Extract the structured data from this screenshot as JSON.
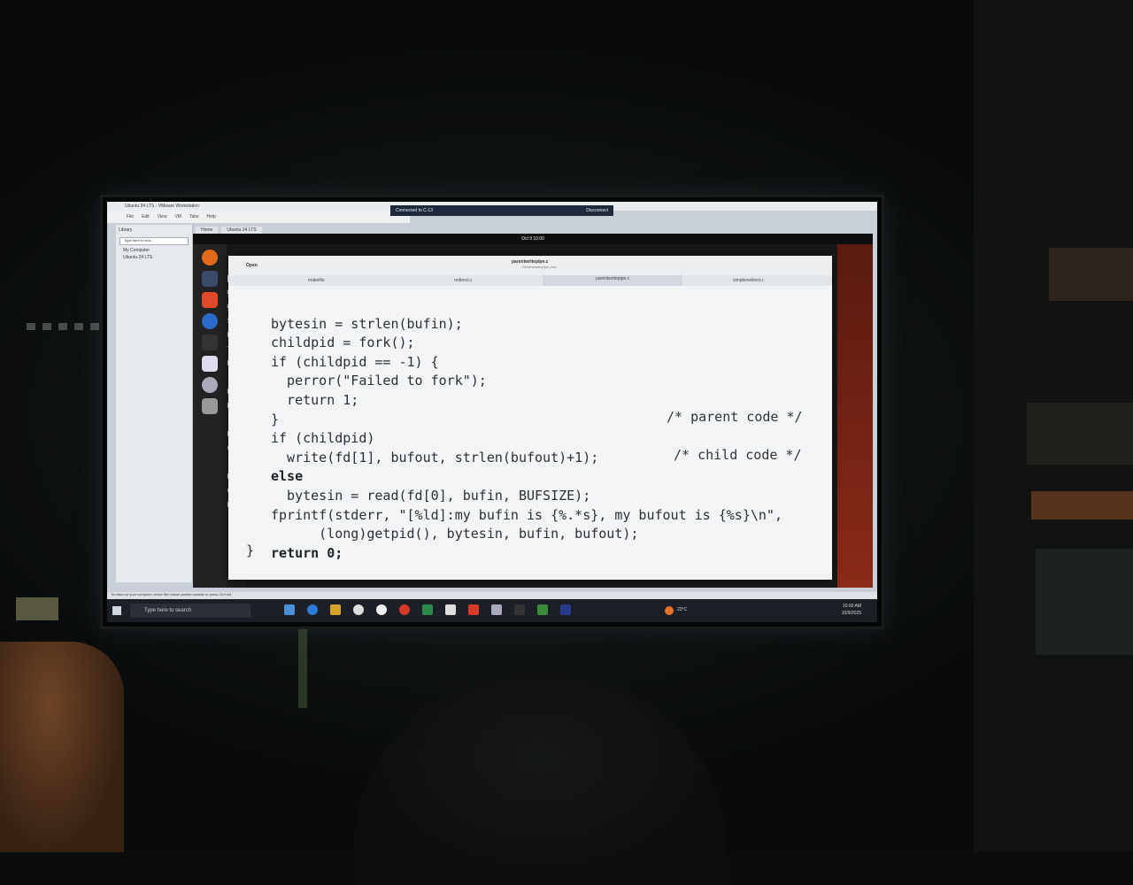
{
  "vmware": {
    "title": "Ubuntu 24 LTS - VMware Workstation",
    "menu": [
      "File",
      "Edit",
      "View",
      "VM",
      "Tabs",
      "Help"
    ],
    "library_label": "Library",
    "library_search_placeholder": "Type here to sea...",
    "library_items": [
      "My Computer",
      "Ubuntu 24 LTS"
    ],
    "tabs": [
      "Home",
      "Ubuntu 24 LTS"
    ],
    "status_hint": "To return to your computer, move the mouse pointer outside or press Ctrl+Alt."
  },
  "rdp": {
    "connected": "Connected to C-13",
    "disconnect": "Disconnect"
  },
  "ubuntu": {
    "clock": "Oct 9 10:00"
  },
  "terminal_fragments": [
    "pol",
    "gno",
    "gdm",
    "sp2",
    "nad",
    "t",
    "nad",
    " 11",
    "nad",
    "nad",
    "",
    "nad",
    "c",
    "",
    "nad",
    "c >",
    "nad"
  ],
  "editor": {
    "open_label": "Open",
    "filename": "parentwritepipe.c",
    "path": "~/Downloads/pipe_test",
    "tabs": [
      "makefile",
      "redirect.c",
      "parentwritepipe.c",
      "simpleredirect.c"
    ],
    "code_lines": [
      "bytesin = strlen(bufin);",
      "childpid = fork();",
      "if (childpid == -1) {",
      "  perror(\"Failed to fork\");",
      "  return 1;",
      "}",
      "if (childpid)",
      "  write(fd[1], bufout, strlen(bufout)+1);",
      "else",
      "  bytesin = read(fd[0], bufin, BUFSIZE);",
      "fprintf(stderr, \"[%ld]:my bufin is {%.*s}, my bufout is {%s}\\n\",",
      "      (long)getpid(), bytesin, bufin, bufout);",
      "return 0;"
    ],
    "comment_parent": "/* parent code */",
    "comment_child": "/* child code */",
    "closing_brace": "}"
  },
  "taskbar": {
    "search_placeholder": "Type here to search",
    "weather": "23°C",
    "time": "10:00 AM",
    "date": "10/9/2025"
  }
}
